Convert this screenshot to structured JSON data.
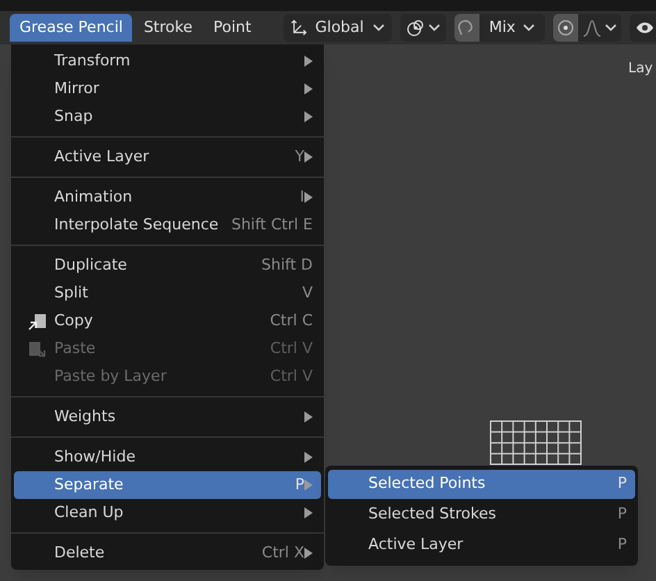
{
  "header_tabs": [
    {
      "label": "Grease Pencil",
      "selected": true
    },
    {
      "label": "Stroke",
      "selected": false
    },
    {
      "label": "Point",
      "selected": false
    }
  ],
  "toolbar": {
    "orientation": "Global",
    "blend": "Mix",
    "snap_on": true,
    "proportional_on": true
  },
  "viewport": {
    "corner_label": "Lay"
  },
  "menu": [
    [
      {
        "label": "Transform",
        "submenu": true,
        "disabled": false,
        "selected": false,
        "kind": "plain"
      },
      {
        "label": "Mirror",
        "submenu": true,
        "disabled": false,
        "selected": false,
        "kind": "plain"
      },
      {
        "label": "Snap",
        "submenu": true,
        "disabled": false,
        "selected": false,
        "kind": "plain"
      }
    ],
    [
      {
        "label": "Active Layer",
        "shortcut": "Y",
        "submenu": true,
        "disabled": false,
        "selected": false,
        "kind": "plain"
      }
    ],
    [
      {
        "label": "Animation",
        "shortcut": "I",
        "submenu": true,
        "disabled": false,
        "selected": false,
        "kind": "plain"
      },
      {
        "label": "Interpolate Sequence",
        "shortcut": "Shift Ctrl E",
        "submenu": false,
        "disabled": false,
        "selected": false,
        "kind": "plain"
      }
    ],
    [
      {
        "label": "Duplicate",
        "shortcut": "Shift D",
        "submenu": false,
        "disabled": false,
        "selected": false,
        "kind": "plain"
      },
      {
        "label": "Split",
        "shortcut": "V",
        "submenu": false,
        "disabled": false,
        "selected": false,
        "kind": "plain"
      },
      {
        "label": "Copy",
        "shortcut": "Ctrl C",
        "submenu": false,
        "disabled": false,
        "selected": false,
        "kind": "copy"
      },
      {
        "label": "Paste",
        "shortcut": "Ctrl V",
        "submenu": false,
        "disabled": true,
        "selected": false,
        "kind": "paste"
      },
      {
        "label": "Paste by Layer",
        "shortcut": "Ctrl V",
        "submenu": false,
        "disabled": true,
        "selected": false,
        "kind": "plain"
      }
    ],
    [
      {
        "label": "Weights",
        "submenu": true,
        "disabled": false,
        "selected": false,
        "kind": "plain"
      }
    ],
    [
      {
        "label": "Show/Hide",
        "submenu": true,
        "disabled": false,
        "selected": false,
        "kind": "plain"
      },
      {
        "label": "Separate",
        "shortcut": "P",
        "submenu": true,
        "disabled": false,
        "selected": true,
        "kind": "plain"
      },
      {
        "label": "Clean Up",
        "submenu": true,
        "disabled": false,
        "selected": false,
        "kind": "plain"
      }
    ],
    [
      {
        "label": "Delete",
        "shortcut": "Ctrl X",
        "submenu": true,
        "disabled": false,
        "selected": false,
        "kind": "plain"
      }
    ]
  ],
  "submenu": [
    {
      "label": "Selected Points",
      "shortcut": "P",
      "selected": true
    },
    {
      "label": "Selected Strokes",
      "shortcut": "P",
      "selected": false
    },
    {
      "label": "Active Layer",
      "shortcut": "P",
      "selected": false
    }
  ]
}
